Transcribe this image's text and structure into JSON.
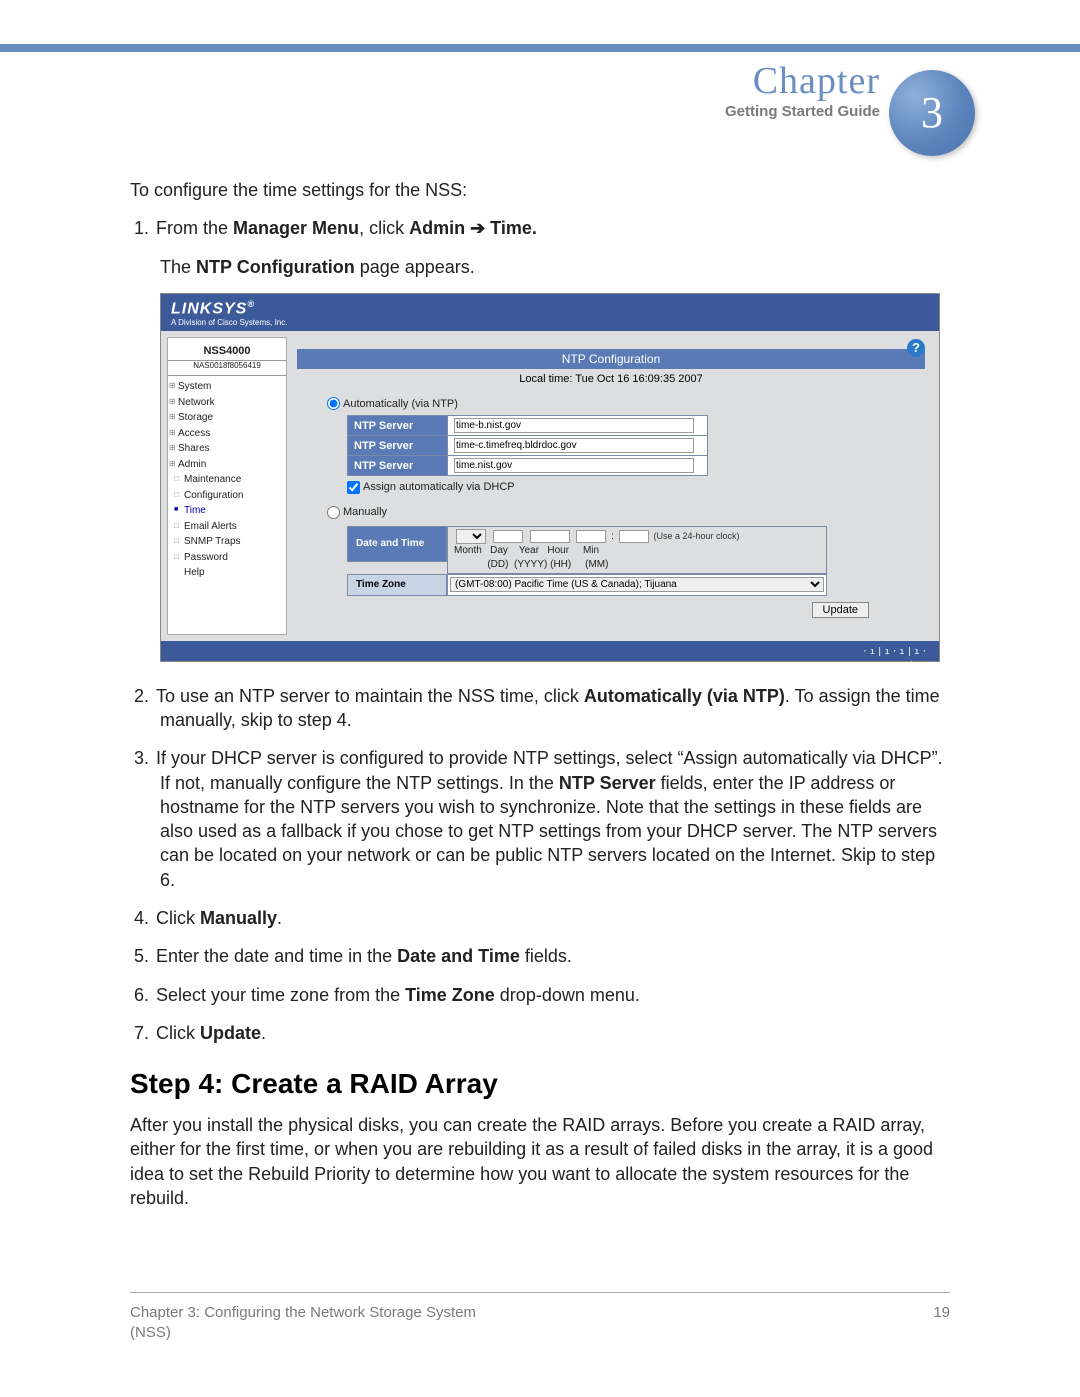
{
  "header": {
    "chapter_word": "Chapter",
    "guide": "Getting Started Guide",
    "chapter_num": "3"
  },
  "intro": "To configure the time settings for the NSS:",
  "step1_pre": "From the ",
  "step1_bold1": "Manager Menu",
  "step1_mid": ", click ",
  "step1_bold2": "Admin",
  "step1_arrow": "  ➔  ",
  "step1_bold3": "Time.",
  "step1_sub_pre": "The ",
  "step1_sub_bold": "NTP Configuration",
  "step1_sub_post": " page appears.",
  "shot": {
    "brand": "LINKSYS",
    "brand_tag": "A Division of Cisco Systems, Inc.",
    "model": "NSS4000",
    "serial": "NAS0018f8056419",
    "nav": {
      "system": "System",
      "network": "Network",
      "storage": "Storage",
      "access": "Access",
      "shares": "Shares",
      "admin": "Admin",
      "maintenance": "Maintenance",
      "configuration": "Configuration",
      "time": "Time",
      "email": "Email Alerts",
      "snmp": "SNMP Traps",
      "password": "Password",
      "help": "Help"
    },
    "help_icon": "?",
    "panel_title": "NTP Configuration",
    "local_time": "Local time: Tue Oct 16 16:09:35 2007",
    "auto_label": "Automatically (via NTP)",
    "ntp_header": "NTP Server",
    "ntp1": "time-b.nist.gov",
    "ntp2": "time-c.timefreq.bldrdoc.gov",
    "ntp3": "time.nist.gov",
    "dhcp_label": "Assign automatically via DHCP",
    "manual_label": "Manually",
    "dt_header": "Date and Time",
    "dt_cols": "Month   Day    Year   Hour     Min",
    "dt_cols2": "            (DD)  (YYYY) (HH)     (MM)",
    "dt_note": "(Use a 24-hour clock)",
    "tz_header": "Time Zone",
    "tz_value": "(GMT-08:00) Pacific Time (US & Canada); Tijuana",
    "update": "Update",
    "footer_brand": "cisco"
  },
  "step2_pre": "To use an NTP server to maintain the NSS time, click ",
  "step2_bold": "Automatically (via NTP)",
  "step2_post": ". To assign the time manually, skip to step 4.",
  "step3_pre": "If your DHCP server is configured to provide NTP settings, select “Assign automatically via DHCP”. If not, manually configure the NTP settings. In the ",
  "step3_bold": "NTP Server",
  "step3_post": " fields, enter the IP address or hostname for the NTP servers you wish to synchronize. Note that the settings in these fields are also used as a fallback if you chose to get NTP settings from your DHCP server. The NTP servers can be located on your network or can be public NTP servers located on the Internet. Skip to step 6.",
  "step4_pre": "Click ",
  "step4_bold": "Manually",
  "step4_post": ".",
  "step5_pre": "Enter the date and time in the ",
  "step5_bold": "Date and Time",
  "step5_post": " fields.",
  "step6_pre": "Select your time zone from the ",
  "step6_bold": "Time Zone",
  "step6_post": " drop-down menu.",
  "step7_pre": "Click ",
  "step7_bold": "Update",
  "step7_post": ".",
  "section_heading": "Step 4: Create a RAID Array",
  "section_body": "After you install the physical disks, you can create the RAID arrays. Before you create a RAID array, either for the first time, or when you are rebuilding it as a result of failed disks in the array, it is a good idea to set the Rebuild Priority to determine how you want to allocate the system resources for the rebuild.",
  "footer": {
    "left1": "Chapter 3: Configuring the Network Storage System",
    "left2": "(NSS)",
    "page": "19"
  }
}
